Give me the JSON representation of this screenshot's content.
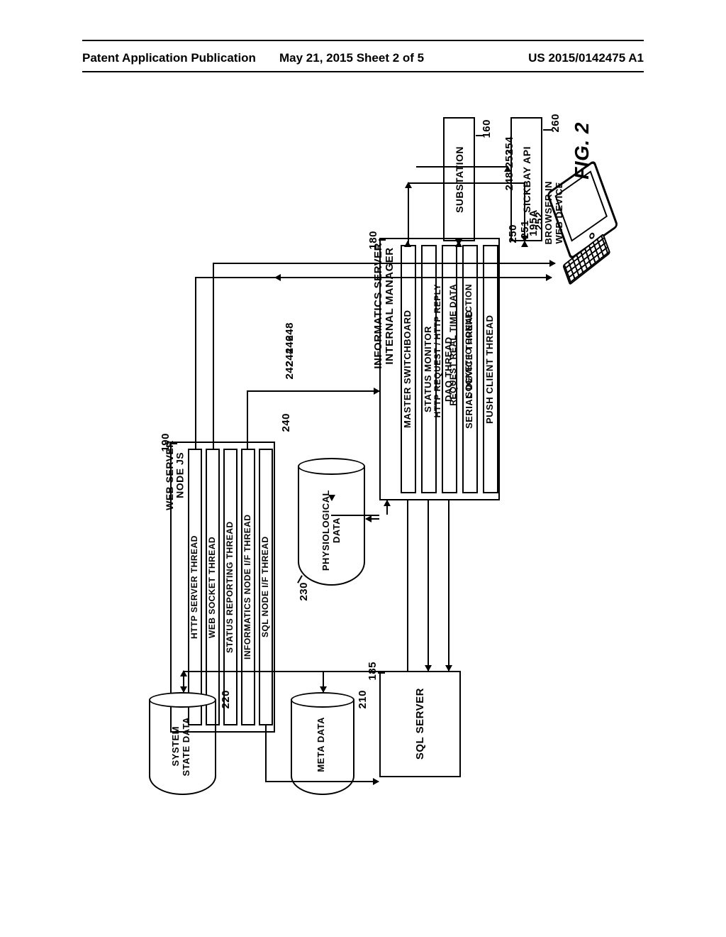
{
  "header": {
    "left": "Patent Application Publication",
    "center": "May 21, 2015  Sheet 2 of 5",
    "right": "US 2015/0142475 A1"
  },
  "figure_label": "FIG. 2",
  "boxes": {
    "sickbay_api": "SICKBAY API",
    "substation": "SUBSTATION",
    "sql_server": "SQL SERVER",
    "browser_device": "BROWSER IN\nWEB DEVICE"
  },
  "informatics_server": {
    "title_line1": "INFORMATICS SERVER",
    "title_line2": "INTERNAL MANAGER",
    "bars": [
      "MASTER SWITCHBOARD",
      "STATUS MONITOR",
      "DAQ THREAD",
      "SERIAL DEVICE THREAD",
      "PUSH CLIENT THREAD"
    ]
  },
  "web_server": {
    "title_line1": "WEB SERVER",
    "title_line2": "NODE JS",
    "bars": [
      "HTTP SERVER THREAD",
      "WEB SOCKET THREAD",
      "STATUS REPORTING THREAD",
      "INFORMATICS NODE I/F THREAD",
      "SQL NODE I/F THREAD"
    ]
  },
  "cylinders": {
    "physiological": "PHYSIOLOGICAL\nDATA",
    "meta": "META DATA",
    "system_state": "SYSTEM\nSTATE DATA"
  },
  "connection_labels": [
    "HTTP REQUEST / HTTP REPLY",
    "REQUEST REAL TIME DATA",
    "SOCKET IO CONNECTION"
  ],
  "ref_numbers": {
    "r160": "160",
    "r180": "180",
    "r185": "185",
    "r190": "190",
    "r195A": "195A",
    "r210": "210",
    "r220": "220",
    "r230": "230",
    "r240": "240",
    "r242": "242",
    "r244": "244",
    "r246": "246",
    "r248_web": "248",
    "r248_inf": "248",
    "r250": "250",
    "r251": "251",
    "r252": "252",
    "r253": "253",
    "r254": "254",
    "r260": "260"
  }
}
